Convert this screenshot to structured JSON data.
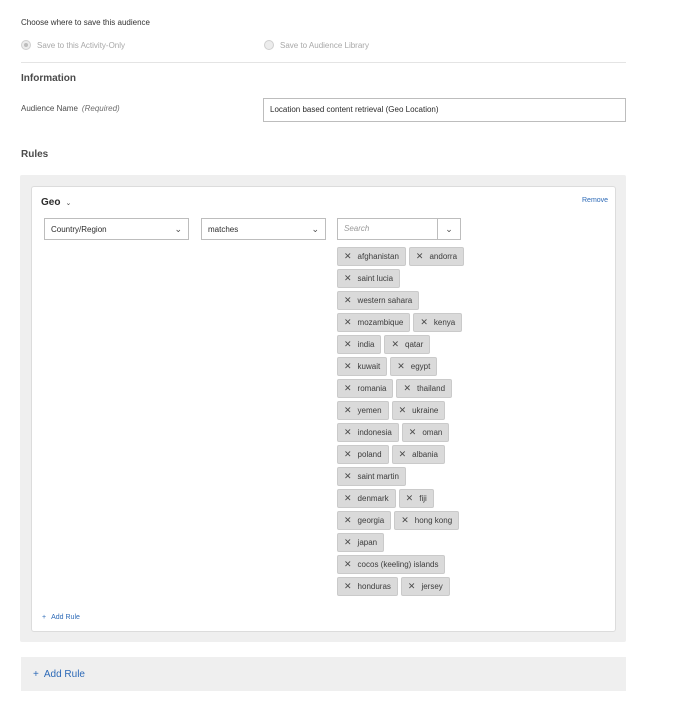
{
  "save_section": {
    "title": "Choose where to save this audience",
    "options": [
      {
        "label": "Save to this Activity-Only",
        "selected": true
      },
      {
        "label": "Save to Audience Library",
        "selected": false
      }
    ]
  },
  "information": {
    "heading": "Information",
    "audience_name_label": "Audience Name",
    "required_text": "(Required)",
    "audience_name_value": "Location based content retrieval (Geo Location)"
  },
  "rules": {
    "heading": "Rules",
    "rule": {
      "title": "Geo",
      "remove_label": "Remove",
      "attribute": "Country/Region",
      "operator": "matches",
      "search_placeholder": "Search",
      "tag_rows": [
        [
          "afghanistan",
          "andorra"
        ],
        [
          "saint lucia"
        ],
        [
          "western sahara"
        ],
        [
          "mozambique",
          "kenya"
        ],
        [
          "india",
          "qatar"
        ],
        [
          "kuwait",
          "egypt"
        ],
        [
          "romania",
          "thailand"
        ],
        [
          "yemen",
          "ukraine"
        ],
        [
          "indonesia",
          "oman"
        ],
        [
          "poland",
          "albania"
        ],
        [
          "saint martin"
        ],
        [
          "denmark",
          "fiji"
        ],
        [
          "georgia",
          "hong kong"
        ],
        [
          "japan"
        ],
        [
          "cocos (keeling) islands"
        ],
        [
          "honduras",
          "jersey"
        ]
      ],
      "add_rule_small_label": "Add Rule"
    },
    "add_rule_label": "Add Rule"
  },
  "colors": {
    "link": "#2d6ab7",
    "tag_bg": "#dadada",
    "panel_bg": "#efefef"
  },
  "icons": {
    "remove_tag": "close-icon",
    "dropdown": "chevron-down-icon",
    "add": "plus-icon"
  }
}
